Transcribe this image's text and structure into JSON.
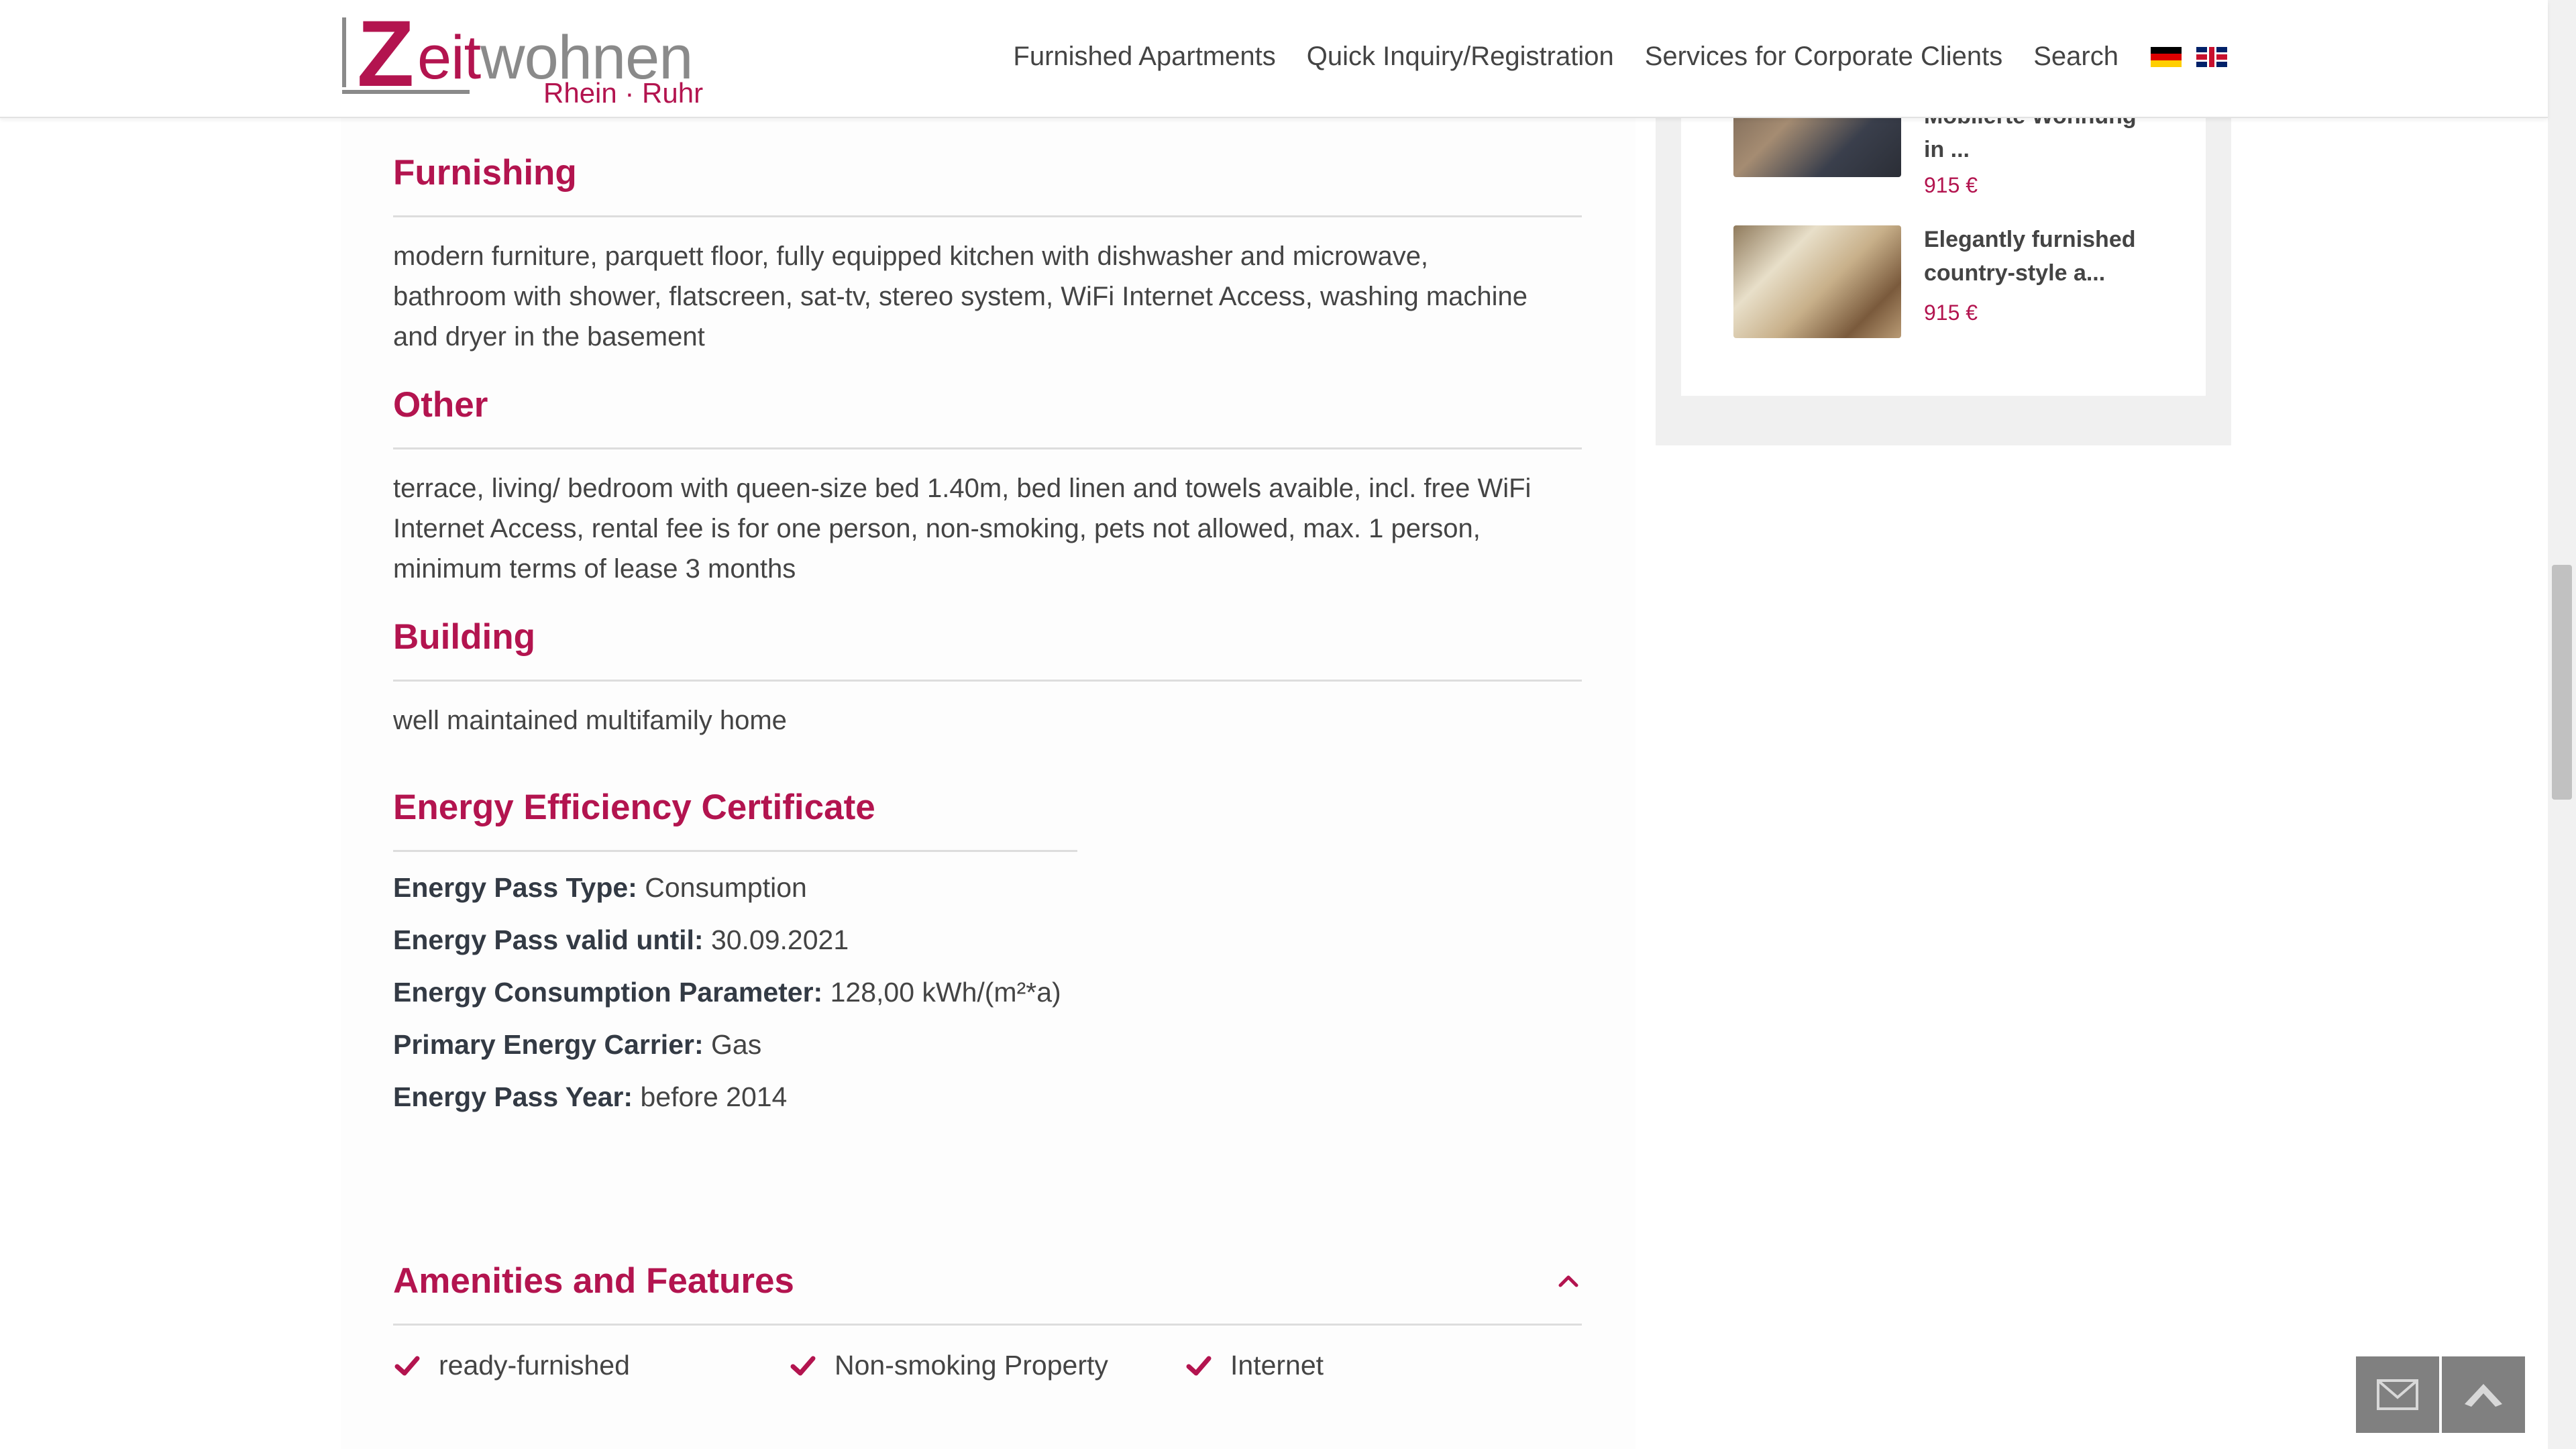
{
  "header": {
    "logo": {
      "z": "Z",
      "eit": "eit",
      "wohnen": "wohnen",
      "sub": "Rhein · Ruhr"
    },
    "nav": [
      {
        "label": "Furnished Apartments"
      },
      {
        "label": "Quick Inquiry/Registration"
      },
      {
        "label": "Services for Corporate Clients"
      },
      {
        "label": "Search"
      }
    ],
    "flags": [
      "german-flag-icon",
      "uk-flag-icon"
    ]
  },
  "main": {
    "furnishing": {
      "title": "Furnishing",
      "text": "modern furniture, parquett floor, fully equipped kitchen with dishwasher and microwave, bathroom with shower, flatscreen, sat-tv, stereo system, WiFi Internet Access, washing machine and dryer in the basement"
    },
    "other": {
      "title": "Other",
      "text": "terrace, living/ bedroom with queen-size bed 1.40m, bed linen and towels avaible, incl. free WiFi Internet Access, rental fee is for one person, non-smoking, pets not allowed, max. 1 person, minimum terms of lease 3 months"
    },
    "building": {
      "title": "Building",
      "text": "well maintained multifamily home"
    },
    "energy": {
      "title": "Energy Efficiency Certificate",
      "rows": [
        {
          "label": "Energy Pass Type:",
          "value": "Consumption"
        },
        {
          "label": "Energy Pass valid until:",
          "value": "30.09.2021"
        },
        {
          "label": "Energy Consumption Parameter:",
          "value": "128,00 kWh/(m²*a)"
        },
        {
          "label": "Primary Energy Carrier:",
          "value": "Gas"
        },
        {
          "label": "Energy Pass Year:",
          "value": "before 2014"
        }
      ]
    },
    "amenities": {
      "title": "Amenities and Features",
      "items": [
        {
          "label": "ready-furnished"
        },
        {
          "label": "Non-smoking Property"
        },
        {
          "label": "Internet"
        }
      ]
    }
  },
  "sidebar": {
    "listings": [
      {
        "title_line1": "Möblierte Wohnung",
        "title_line2": "in ...",
        "price": "915 €"
      },
      {
        "title_line1": "Elegantly furnished",
        "title_line2": "country-style a...",
        "price": "915 €"
      }
    ]
  },
  "colors": {
    "accent": "#b3144f",
    "text": "#444444",
    "button": "#808080"
  }
}
